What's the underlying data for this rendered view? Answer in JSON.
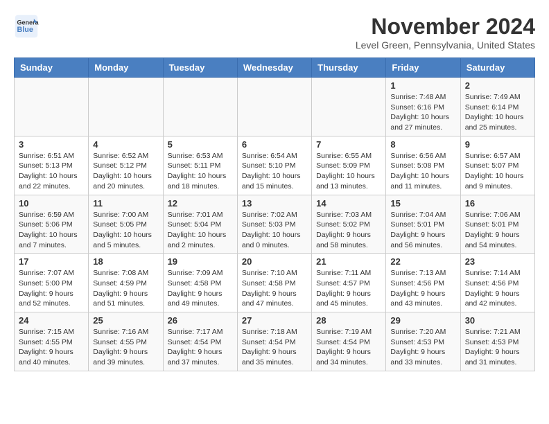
{
  "header": {
    "logo_line1": "General",
    "logo_line2": "Blue",
    "month_year": "November 2024",
    "location": "Level Green, Pennsylvania, United States"
  },
  "days_of_week": [
    "Sunday",
    "Monday",
    "Tuesday",
    "Wednesday",
    "Thursday",
    "Friday",
    "Saturday"
  ],
  "weeks": [
    [
      {
        "day": "",
        "info": ""
      },
      {
        "day": "",
        "info": ""
      },
      {
        "day": "",
        "info": ""
      },
      {
        "day": "",
        "info": ""
      },
      {
        "day": "",
        "info": ""
      },
      {
        "day": "1",
        "info": "Sunrise: 7:48 AM\nSunset: 6:16 PM\nDaylight: 10 hours and 27 minutes."
      },
      {
        "day": "2",
        "info": "Sunrise: 7:49 AM\nSunset: 6:14 PM\nDaylight: 10 hours and 25 minutes."
      }
    ],
    [
      {
        "day": "3",
        "info": "Sunrise: 6:51 AM\nSunset: 5:13 PM\nDaylight: 10 hours and 22 minutes."
      },
      {
        "day": "4",
        "info": "Sunrise: 6:52 AM\nSunset: 5:12 PM\nDaylight: 10 hours and 20 minutes."
      },
      {
        "day": "5",
        "info": "Sunrise: 6:53 AM\nSunset: 5:11 PM\nDaylight: 10 hours and 18 minutes."
      },
      {
        "day": "6",
        "info": "Sunrise: 6:54 AM\nSunset: 5:10 PM\nDaylight: 10 hours and 15 minutes."
      },
      {
        "day": "7",
        "info": "Sunrise: 6:55 AM\nSunset: 5:09 PM\nDaylight: 10 hours and 13 minutes."
      },
      {
        "day": "8",
        "info": "Sunrise: 6:56 AM\nSunset: 5:08 PM\nDaylight: 10 hours and 11 minutes."
      },
      {
        "day": "9",
        "info": "Sunrise: 6:57 AM\nSunset: 5:07 PM\nDaylight: 10 hours and 9 minutes."
      }
    ],
    [
      {
        "day": "10",
        "info": "Sunrise: 6:59 AM\nSunset: 5:06 PM\nDaylight: 10 hours and 7 minutes."
      },
      {
        "day": "11",
        "info": "Sunrise: 7:00 AM\nSunset: 5:05 PM\nDaylight: 10 hours and 5 minutes."
      },
      {
        "day": "12",
        "info": "Sunrise: 7:01 AM\nSunset: 5:04 PM\nDaylight: 10 hours and 2 minutes."
      },
      {
        "day": "13",
        "info": "Sunrise: 7:02 AM\nSunset: 5:03 PM\nDaylight: 10 hours and 0 minutes."
      },
      {
        "day": "14",
        "info": "Sunrise: 7:03 AM\nSunset: 5:02 PM\nDaylight: 9 hours and 58 minutes."
      },
      {
        "day": "15",
        "info": "Sunrise: 7:04 AM\nSunset: 5:01 PM\nDaylight: 9 hours and 56 minutes."
      },
      {
        "day": "16",
        "info": "Sunrise: 7:06 AM\nSunset: 5:01 PM\nDaylight: 9 hours and 54 minutes."
      }
    ],
    [
      {
        "day": "17",
        "info": "Sunrise: 7:07 AM\nSunset: 5:00 PM\nDaylight: 9 hours and 52 minutes."
      },
      {
        "day": "18",
        "info": "Sunrise: 7:08 AM\nSunset: 4:59 PM\nDaylight: 9 hours and 51 minutes."
      },
      {
        "day": "19",
        "info": "Sunrise: 7:09 AM\nSunset: 4:58 PM\nDaylight: 9 hours and 49 minutes."
      },
      {
        "day": "20",
        "info": "Sunrise: 7:10 AM\nSunset: 4:58 PM\nDaylight: 9 hours and 47 minutes."
      },
      {
        "day": "21",
        "info": "Sunrise: 7:11 AM\nSunset: 4:57 PM\nDaylight: 9 hours and 45 minutes."
      },
      {
        "day": "22",
        "info": "Sunrise: 7:13 AM\nSunset: 4:56 PM\nDaylight: 9 hours and 43 minutes."
      },
      {
        "day": "23",
        "info": "Sunrise: 7:14 AM\nSunset: 4:56 PM\nDaylight: 9 hours and 42 minutes."
      }
    ],
    [
      {
        "day": "24",
        "info": "Sunrise: 7:15 AM\nSunset: 4:55 PM\nDaylight: 9 hours and 40 minutes."
      },
      {
        "day": "25",
        "info": "Sunrise: 7:16 AM\nSunset: 4:55 PM\nDaylight: 9 hours and 39 minutes."
      },
      {
        "day": "26",
        "info": "Sunrise: 7:17 AM\nSunset: 4:54 PM\nDaylight: 9 hours and 37 minutes."
      },
      {
        "day": "27",
        "info": "Sunrise: 7:18 AM\nSunset: 4:54 PM\nDaylight: 9 hours and 35 minutes."
      },
      {
        "day": "28",
        "info": "Sunrise: 7:19 AM\nSunset: 4:54 PM\nDaylight: 9 hours and 34 minutes."
      },
      {
        "day": "29",
        "info": "Sunrise: 7:20 AM\nSunset: 4:53 PM\nDaylight: 9 hours and 33 minutes."
      },
      {
        "day": "30",
        "info": "Sunrise: 7:21 AM\nSunset: 4:53 PM\nDaylight: 9 hours and 31 minutes."
      }
    ]
  ]
}
